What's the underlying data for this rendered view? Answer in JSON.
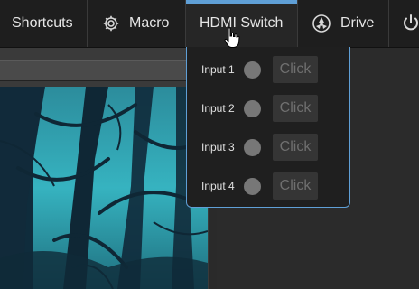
{
  "toolbar": {
    "shortcuts_label": "Shortcuts",
    "macro_label": "Macro",
    "hdmi_label": "HDMI Switch",
    "drive_label": "Drive"
  },
  "hdmi_menu": {
    "inputs": [
      {
        "label": "Input 1",
        "button": "Click"
      },
      {
        "label": "Input 2",
        "button": "Click"
      },
      {
        "label": "Input 3",
        "button": "Click"
      },
      {
        "label": "Input 4",
        "button": "Click"
      }
    ]
  },
  "colors": {
    "accent": "#5f9fd6",
    "toolbar_bg": "#1e1e1e",
    "dot": "#777777"
  },
  "icons": [
    "gear-icon",
    "drive-icon",
    "power-icon",
    "hand-cursor-icon"
  ]
}
